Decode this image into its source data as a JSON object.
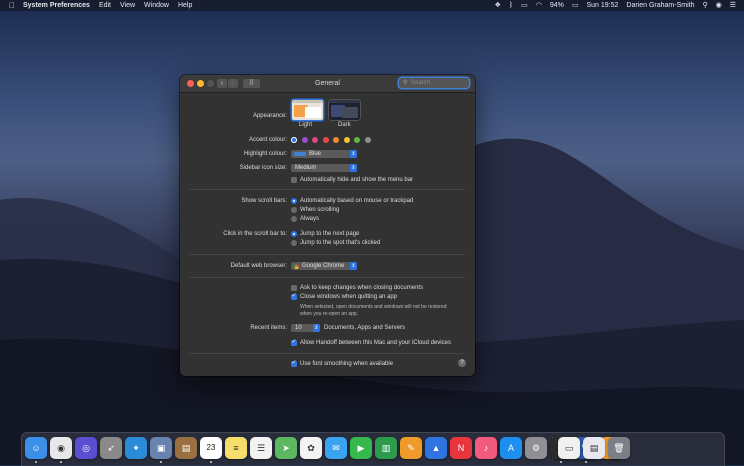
{
  "menubar": {
    "app_name": "System Preferences",
    "menus": [
      "Edit",
      "View",
      "Window",
      "Help"
    ],
    "battery": "94%",
    "clock": "Sun 19:52",
    "user": "Darien Graham-Smith"
  },
  "window": {
    "title": "General",
    "search_placeholder": "Search"
  },
  "appearance": {
    "label": "Appearance:",
    "options": [
      "Light",
      "Dark"
    ],
    "selected": "Light"
  },
  "accent": {
    "label": "Accent colour:",
    "colors": [
      "#2f74e0",
      "#9b4fd0",
      "#e6448a",
      "#e74c4c",
      "#f08a2c",
      "#f4c431",
      "#5fb83b",
      "#8e8e8e"
    ]
  },
  "highlight": {
    "label": "Highlight colour:",
    "value": "Blue",
    "swatch": "#3f7fd8"
  },
  "sidebar_icon": {
    "label": "Sidebar icon size:",
    "value": "Medium"
  },
  "menubar_autohide": {
    "label": "Automatically hide and show the menu bar",
    "checked": false
  },
  "scroll_bars": {
    "label": "Show scroll bars:",
    "options": [
      "Automatically based on mouse or trackpad",
      "When scrolling",
      "Always"
    ],
    "selected": 0
  },
  "click_scroll": {
    "label": "Click in the scroll bar to:",
    "options": [
      "Jump to the next page",
      "Jump to the spot that's clicked"
    ],
    "selected": 0
  },
  "browser": {
    "label": "Default web browser:",
    "value": "Google Chrome"
  },
  "documents": {
    "ask_keep": "Ask to keep changes when closing documents",
    "close_windows": "Close windows when quitting an app",
    "note_line1": "When selected, open documents and windows will not be restored",
    "note_line2": "when you re-open an app."
  },
  "recent": {
    "label": "Recent items:",
    "value": "10",
    "suffix": "Documents, Apps and Servers"
  },
  "handoff": {
    "label": "Allow Handoff between this Mac and your iCloud devices"
  },
  "font_smoothing": {
    "label": "Use font smoothing when available"
  },
  "help_glyph": "?",
  "dock": {
    "apps": [
      {
        "name": "finder-icon",
        "color": "#3b8fe6",
        "glyph": "☺"
      },
      {
        "name": "chrome-icon",
        "color": "#e8e8e8",
        "glyph": "◉"
      },
      {
        "name": "siri-icon",
        "color": "#5a4fd0",
        "glyph": "◎"
      },
      {
        "name": "launchpad-icon",
        "color": "#8a8a8a",
        "glyph": "➶"
      },
      {
        "name": "safari-icon",
        "color": "#2a8bd8",
        "glyph": "✦"
      },
      {
        "name": "photo-preview-icon",
        "color": "#6a82b0",
        "glyph": "▣"
      },
      {
        "name": "notefile-icon",
        "color": "#9a7040",
        "glyph": "▤"
      },
      {
        "name": "calendar-icon",
        "color": "#ffffff",
        "glyph": "23"
      },
      {
        "name": "notes-icon",
        "color": "#f5df6a",
        "glyph": "≡"
      },
      {
        "name": "reminders-icon",
        "color": "#f2f2f2",
        "glyph": "☰"
      },
      {
        "name": "maps-icon",
        "color": "#5cb860",
        "glyph": "➤"
      },
      {
        "name": "photos-icon",
        "color": "#f3f3f3",
        "glyph": "✿"
      },
      {
        "name": "messages-icon",
        "color": "#3aa4f0",
        "glyph": "✉"
      },
      {
        "name": "facetime-icon",
        "color": "#37b84c",
        "glyph": "▶"
      },
      {
        "name": "numbers-icon",
        "color": "#2d9b4e",
        "glyph": "▥"
      },
      {
        "name": "pages-icon",
        "color": "#f09a2a",
        "glyph": "✎"
      },
      {
        "name": "keynote-icon",
        "color": "#2f74e0",
        "glyph": "▲"
      },
      {
        "name": "news-icon",
        "color": "#e8343c",
        "glyph": "N"
      },
      {
        "name": "music-icon",
        "color": "#f35b7c",
        "glyph": "♪"
      },
      {
        "name": "app-store-icon",
        "color": "#1e8ef0",
        "glyph": "A"
      },
      {
        "name": "system-preferences-icon",
        "color": "#8f8f95",
        "glyph": "⚙"
      },
      {
        "name": "activity-monitor-icon",
        "color": "#2b2b2b",
        "glyph": "∿"
      },
      {
        "name": "word-icon",
        "color": "#2b5aa8",
        "glyph": "W"
      },
      {
        "name": "home-icon",
        "color": "#f39a28",
        "glyph": "⌂"
      },
      {
        "name": "document-icon",
        "color": "#f0f0f0",
        "glyph": "▭"
      },
      {
        "name": "preview-doc-icon",
        "color": "#e8e8ee",
        "glyph": "▤"
      },
      {
        "name": "trash-icon",
        "color": "#7a7f88",
        "glyph": "🗑"
      }
    ]
  }
}
